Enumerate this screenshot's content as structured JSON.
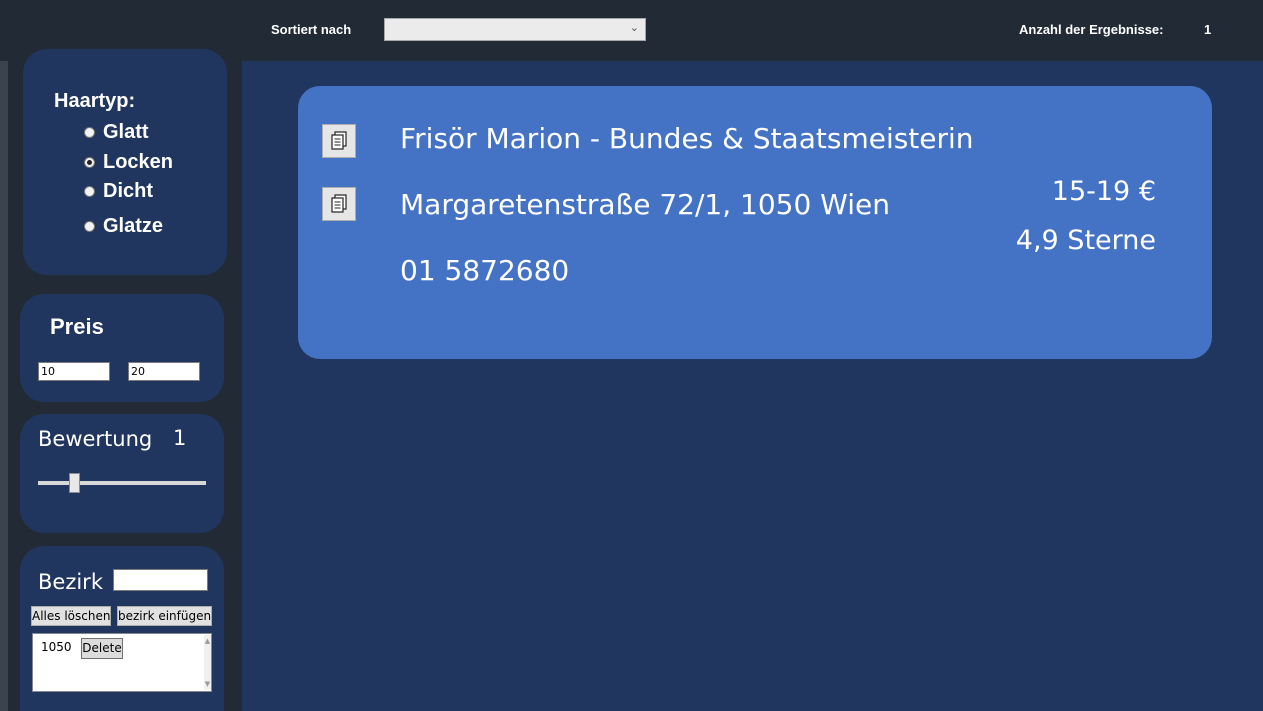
{
  "topbar": {
    "sort_label": "Sortiert nach",
    "sort_value": "",
    "results_label": "Anzahl der Ergebnisse:",
    "results_count": "1"
  },
  "filters": {
    "haartyp": {
      "title": "Haartyp:",
      "options": [
        {
          "label": "Glatt",
          "checked": false
        },
        {
          "label": "Locken",
          "checked": true
        },
        {
          "label": "Dicht",
          "checked": false
        },
        {
          "label": "Glatze",
          "checked": false
        }
      ]
    },
    "preis": {
      "title": "Preis",
      "min_value": "10",
      "max_value": "20"
    },
    "bewertung": {
      "title": "Bewertung",
      "value": "1",
      "slider_fraction": 0.2
    },
    "bezirk": {
      "title": "Bezirk",
      "input_value": "",
      "clear_button": "Alles löschen",
      "add_button": "bezirk einfügen",
      "items": [
        {
          "code": "1050",
          "delete_label": "Delete"
        }
      ]
    }
  },
  "results": [
    {
      "name": "Frisör Marion - Bundes & Staatsmeisterin",
      "address": "Margaretenstraße 72/1, 1050 Wien",
      "phone": "01 5872680",
      "price": "15-19 €",
      "rating": "4,9 Sterne"
    }
  ],
  "colors": {
    "background": "#222a36",
    "panel": "#20365f",
    "card": "#4472c4",
    "text": "#ffffff"
  }
}
